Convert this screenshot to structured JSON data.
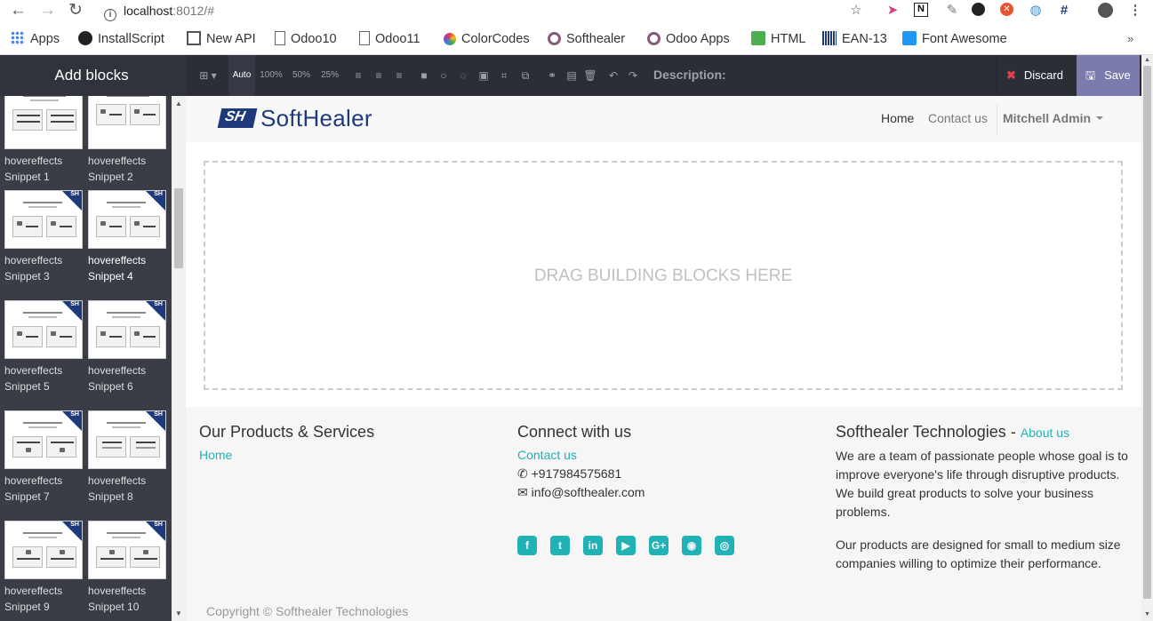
{
  "browser": {
    "url_host": "localhost",
    "url_rest": ":8012/#",
    "bookmarks": [
      {
        "label": "Apps",
        "icon": "apps-grid-icon",
        "color": "#4285f4"
      },
      {
        "label": "InstallScript",
        "icon": "github-icon",
        "color": "#222222"
      },
      {
        "label": "New API",
        "icon": "book-icon",
        "color": "#555555"
      },
      {
        "label": "Odoo10",
        "icon": "page-icon",
        "color": "#666666"
      },
      {
        "label": "Odoo11",
        "icon": "page-icon",
        "color": "#666666"
      },
      {
        "label": "ColorCodes",
        "icon": "color-wheel-icon",
        "color": "#e04040"
      },
      {
        "label": "Softhealer",
        "icon": "odoo-circle-icon",
        "color": "#875a7b"
      },
      {
        "label": "Odoo Apps",
        "icon": "odoo-circle-icon",
        "color": "#875a7b"
      },
      {
        "label": "HTML",
        "icon": "html-icon",
        "color": "#4caf50"
      },
      {
        "label": "EAN-13",
        "icon": "barcode-icon",
        "color": "#1f3a7a"
      },
      {
        "label": "Font Awesome",
        "icon": "flag-icon",
        "color": "#2196f3"
      }
    ]
  },
  "sidebar": {
    "title": "Add blocks",
    "blocks": [
      {
        "line1": "hovereffects",
        "line2": "Snippet 1"
      },
      {
        "line1": "hovereffects",
        "line2": "Snippet 2"
      },
      {
        "line1": "hovereffects",
        "line2": "Snippet 3"
      },
      {
        "line1": "hovereffects",
        "line2": "Snippet 4"
      },
      {
        "line1": "hovereffects",
        "line2": "Snippet 5"
      },
      {
        "line1": "hovereffects",
        "line2": "Snippet 6"
      },
      {
        "line1": "hovereffects",
        "line2": "Snippet 7"
      },
      {
        "line1": "hovereffects",
        "line2": "Snippet 8"
      },
      {
        "line1": "hovereffects",
        "line2": "Snippet 9"
      },
      {
        "line1": "hovereffects",
        "line2": "Snippet 10"
      }
    ],
    "badge": "SH"
  },
  "toolbar": {
    "sizes": [
      "Auto",
      "100%",
      "50%",
      "25%"
    ],
    "description_label": "Description:",
    "discard_label": "Discard",
    "save_label": "Save"
  },
  "site": {
    "logo_text": "SoftHealer",
    "logo_mark": "SH",
    "menu": {
      "home": "Home",
      "contact": "Contact us",
      "admin": "Mitchell Admin"
    },
    "dropzone_text": "DRAG BUILDING BLOCKS HERE"
  },
  "footer": {
    "col1": {
      "title": "Our Products & Services",
      "link": "Home"
    },
    "col2": {
      "title": "Connect with us",
      "link": "Contact us",
      "phone": "+917984575681",
      "email": "info@softhealer.com"
    },
    "col3": {
      "title": "Softhealer Technologies",
      "sep": " - ",
      "link": "About us",
      "p1": "We are a team of passionate people whose goal is to improve everyone's life through disruptive products. We build great products to solve your business problems.",
      "p2": "Our products are designed for small to medium size companies willing to optimize their performance."
    },
    "social": [
      "facebook-icon",
      "twitter-icon",
      "linkedin-icon",
      "youtube-icon",
      "google-plus-icon",
      "github-icon",
      "instagram-icon"
    ],
    "copyright": "Copyright © Softhealer Technologies"
  },
  "colors": {
    "accent": "#21b2b6",
    "brand": "#1f3a7a",
    "save": "#7c7bad",
    "sidebar": "#3a3d45"
  }
}
